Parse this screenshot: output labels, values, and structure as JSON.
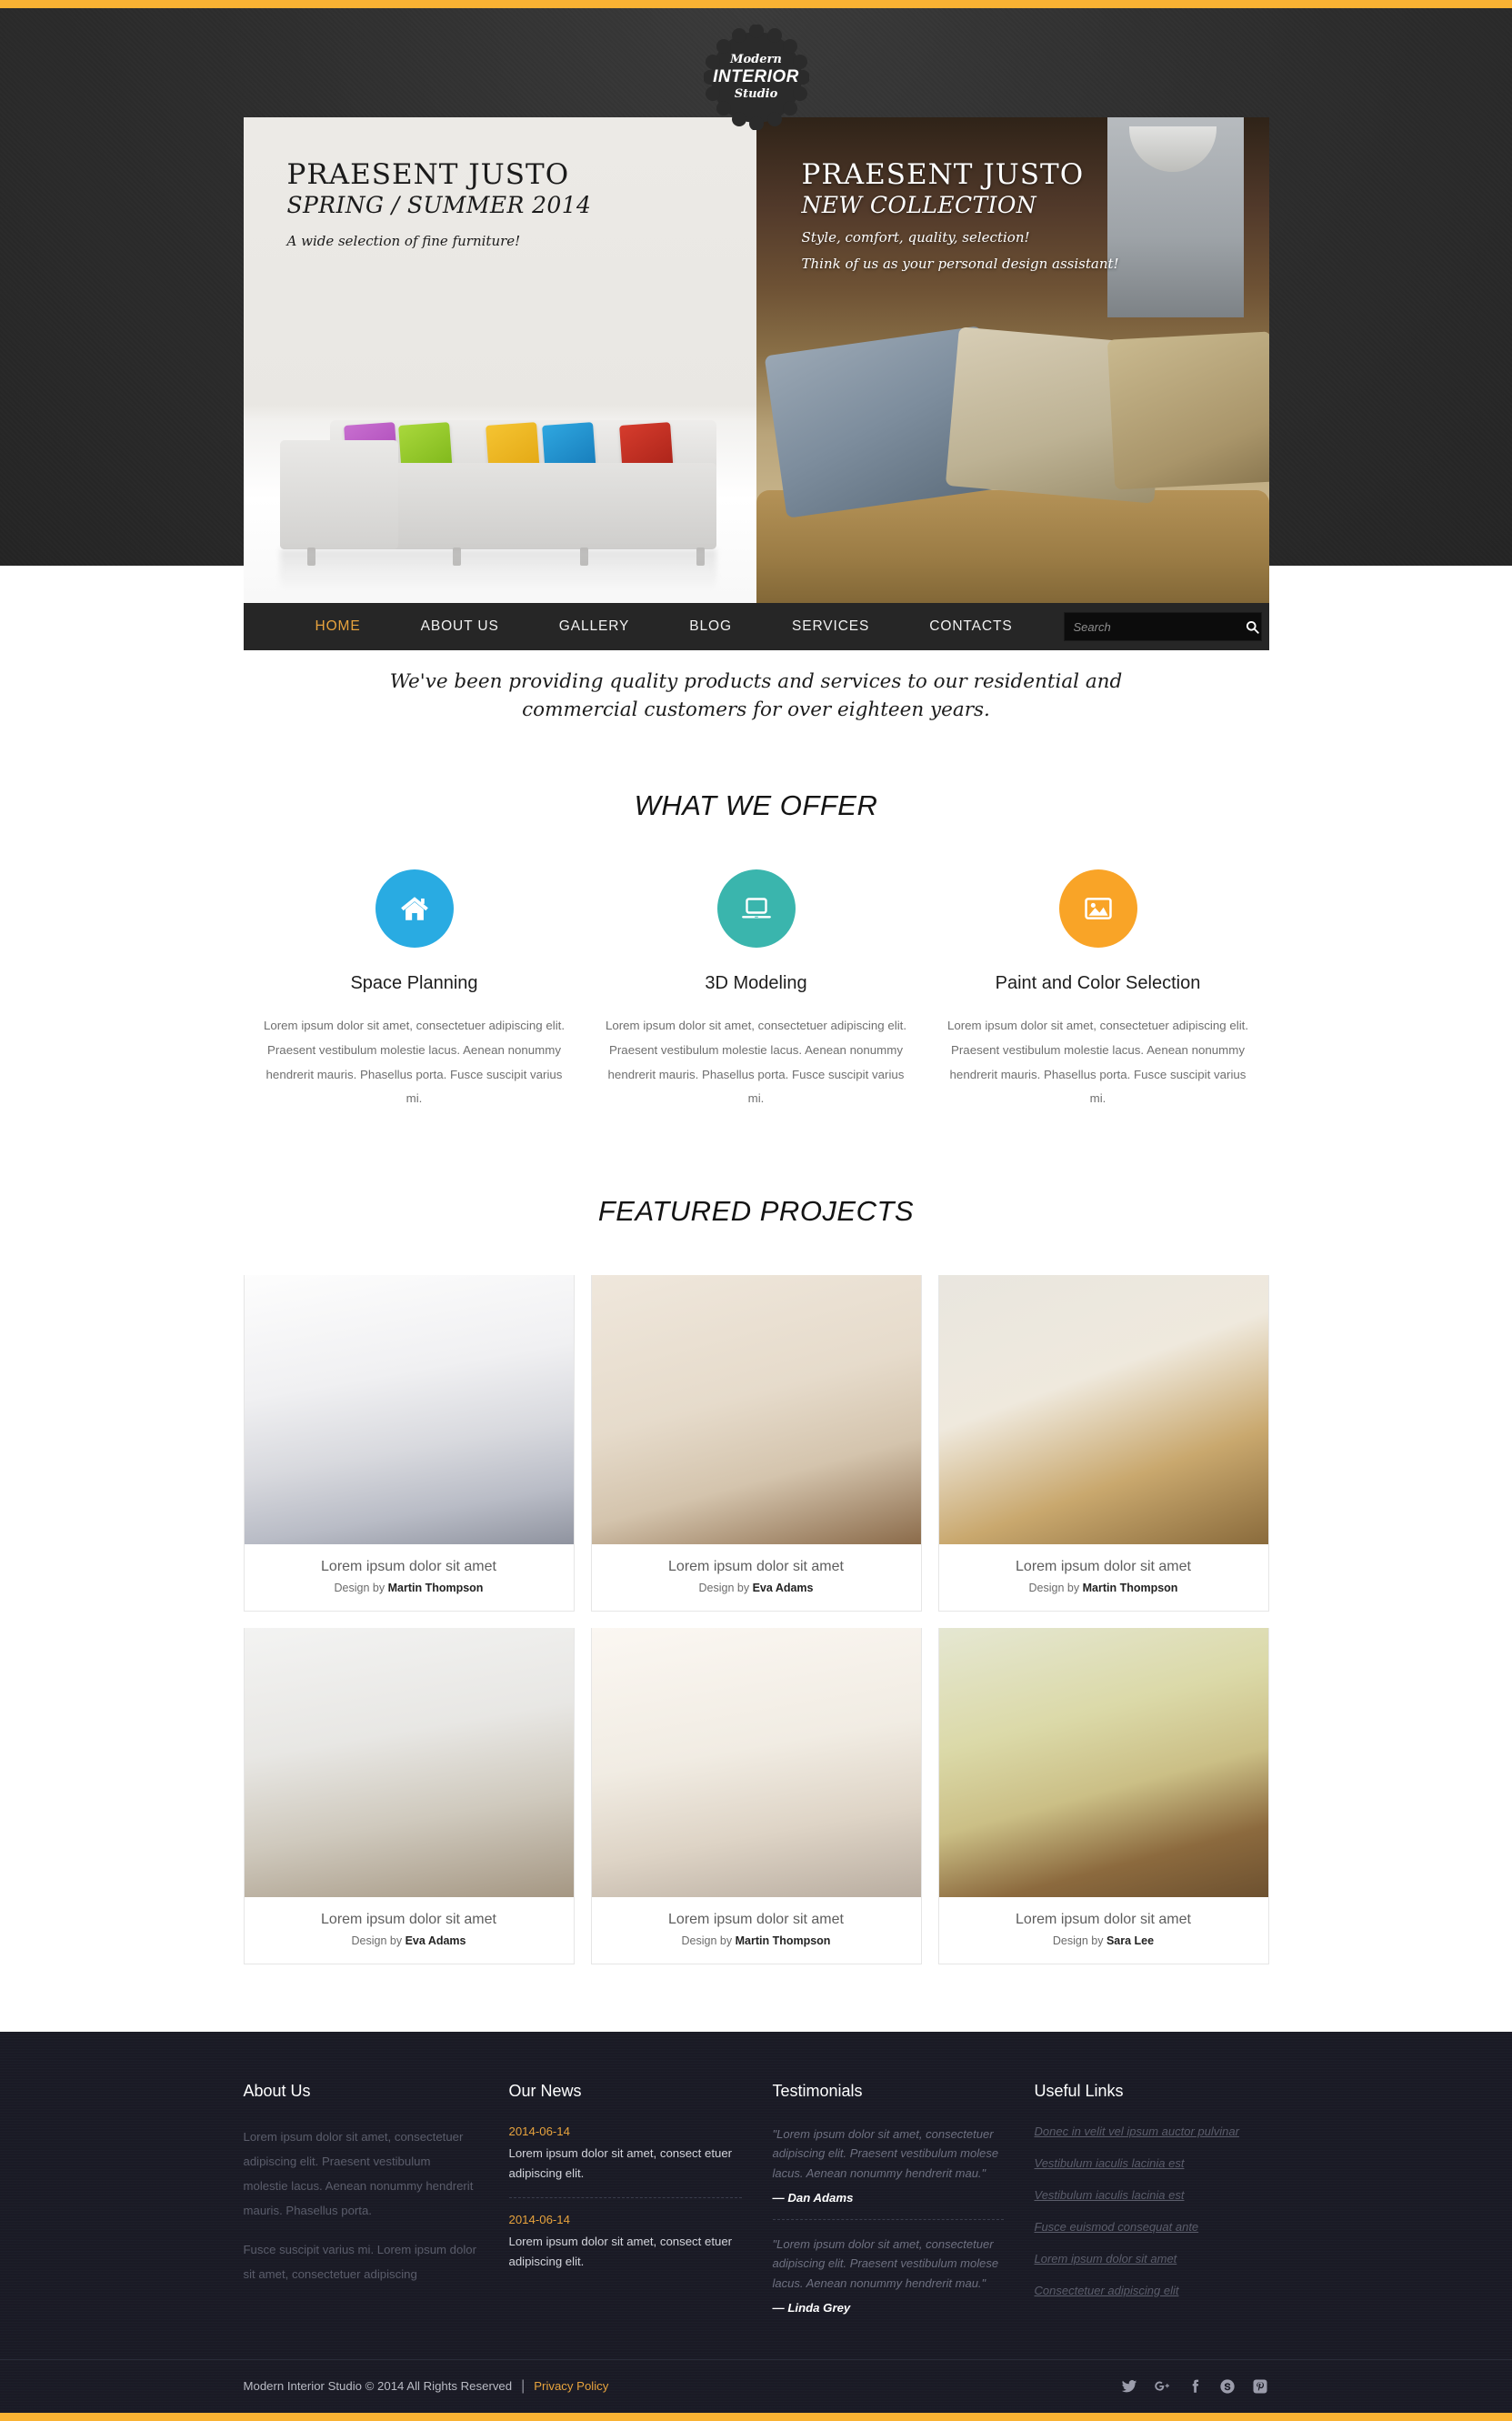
{
  "logo": {
    "line1": "Modern",
    "line2": "INTERIOR",
    "line3": "Studio"
  },
  "slides": [
    {
      "title": "PRAESENT JUSTO",
      "subtitle": "SPRING / SUMMER 2014",
      "line1": "A wide selection of fine furniture!",
      "line2": ""
    },
    {
      "title": "PRAESENT JUSTO",
      "subtitle": "NEW COLLECTION",
      "line1": "Style, comfort, quality, selection!",
      "line2": "Think of us as your personal design assistant!"
    }
  ],
  "nav": {
    "items": [
      {
        "label": "HOME",
        "active": true
      },
      {
        "label": "ABOUT US",
        "active": false
      },
      {
        "label": "GALLERY",
        "active": false
      },
      {
        "label": "BLOG",
        "active": false
      },
      {
        "label": "SERVICES",
        "active": false
      },
      {
        "label": "CONTACTS",
        "active": false
      }
    ],
    "search_placeholder": "Search",
    "search_value": "",
    "search_icon": "search-icon"
  },
  "intro": {
    "tagline": "We've been providing quality products and services to our residential and commercial customers for over eighteen years."
  },
  "offers": {
    "title": "WHAT WE OFFER",
    "body": "Lorem ipsum dolor sit amet, consectetuer adipiscing elit. Praesent vestibulum molestie lacus. Aenean nonummy hendrerit mauris. Phasellus porta. Fusce suscipit varius mi.",
    "items": [
      {
        "title": "Space Planning",
        "icon": "home-icon",
        "color": "#29ABE2"
      },
      {
        "title": "3D Modeling",
        "icon": "laptop-icon",
        "color": "#3AB5AD"
      },
      {
        "title": "Paint and Color Selection",
        "icon": "image-icon",
        "color": "#F9A427"
      }
    ]
  },
  "featured": {
    "title": "FEATURED PROJECTS",
    "design_by_prefix": "Design by ",
    "items": [
      {
        "title": "Lorem ipsum dolor sit amet",
        "author": "Martin Thompson"
      },
      {
        "title": "Lorem ipsum dolor sit amet",
        "author": "Eva Adams"
      },
      {
        "title": "Lorem ipsum dolor sit amet",
        "author": "Martin Thompson"
      },
      {
        "title": "Lorem ipsum dolor sit amet",
        "author": "Eva Adams"
      },
      {
        "title": "Lorem ipsum dolor sit amet",
        "author": "Martin Thompson"
      },
      {
        "title": "Lorem ipsum dolor sit amet",
        "author": "Sara Lee"
      }
    ]
  },
  "footer": {
    "about": {
      "heading": "About Us",
      "p1": "Lorem ipsum dolor sit amet, consectetuer adipiscing elit. Praesent vestibulum molestie lacus. Aenean nonummy hendrerit mauris. Phasellus porta.",
      "p2": "Fusce suscipit varius mi. Lorem ipsum dolor sit amet, consectetuer adipiscing"
    },
    "news": {
      "heading": "Our News",
      "items": [
        {
          "date": "2014-06-14",
          "text": "Lorem ipsum dolor sit amet, consect etuer adipiscing elit."
        },
        {
          "date": "2014-06-14",
          "text": "Lorem ipsum dolor sit amet, consect etuer adipiscing elit."
        }
      ]
    },
    "testimonials": {
      "heading": "Testimonials",
      "items": [
        {
          "quote": "\"Lorem ipsum dolor sit amet, consectetuer adipiscing elit. Praesent vestibulum molese lacus. Aenean nonummy hendrerit mau.\"",
          "author": "— Dan Adams"
        },
        {
          "quote": "\"Lorem ipsum dolor sit amet, consectetuer adipiscing elit. Praesent vestibulum molese lacus. Aenean nonummy hendrerit mau.\"",
          "author": "— Linda Grey"
        }
      ]
    },
    "links": {
      "heading": "Useful Links",
      "items": [
        "Donec in velit vel ipsum auctor pulvinar",
        "Vestibulum iaculis lacinia est",
        "Vestibulum iaculis lacinia est",
        "Fusce euismod consequat ante",
        "Lorem ipsum dolor sit amet",
        "Consectetuer adipiscing elit"
      ]
    },
    "bottom": {
      "copyright": "Modern Interior Studio © 2014 All Rights Reserved",
      "separator": "|",
      "privacy": "Privacy Policy",
      "socials": [
        "twitter-icon",
        "google-plus-icon",
        "facebook-icon",
        "skype-icon",
        "pinterest-icon"
      ]
    }
  },
  "theme": {
    "accent": "#F9B233",
    "gold_text": "#E8A33D",
    "dark": "#262626",
    "footer_bg": "#1a1b26"
  }
}
